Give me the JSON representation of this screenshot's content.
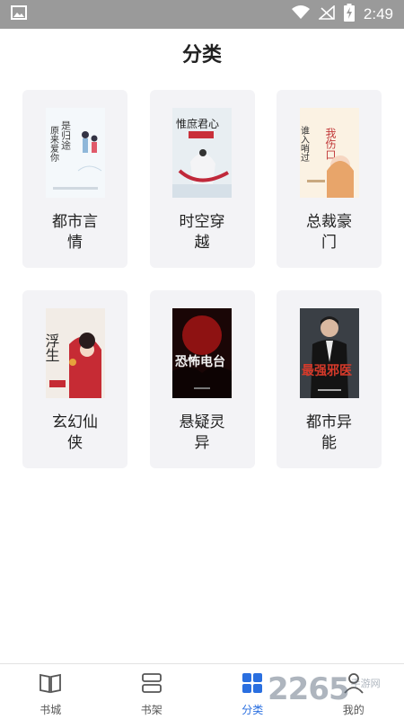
{
  "status_bar": {
    "time": "2:49",
    "background": "#9a9a9a"
  },
  "page": {
    "title": "分类"
  },
  "categories": [
    {
      "label": "都市言情",
      "cover_text": "原来爱你"
    },
    {
      "label": "时空穿越",
      "cover_text": "惟庶君心"
    },
    {
      "label": "总裁豪门",
      "cover_text": "谁入哨过"
    },
    {
      "label": "玄幻仙侠",
      "cover_text": "浮生"
    },
    {
      "label": "悬疑灵异",
      "cover_text": "恐怖电台"
    },
    {
      "label": "都市异能",
      "cover_text": "最强邪医"
    }
  ],
  "bottom_nav": {
    "items": [
      {
        "label": "书城",
        "icon": "book-open-icon"
      },
      {
        "label": "书架",
        "icon": "bookshelf-icon"
      },
      {
        "label": "分类",
        "icon": "category-grid-icon"
      },
      {
        "label": "我的",
        "icon": "person-icon"
      }
    ],
    "active_color": "#2a6fe0"
  },
  "watermark": {
    "number": "2265",
    "text": "手游网"
  }
}
